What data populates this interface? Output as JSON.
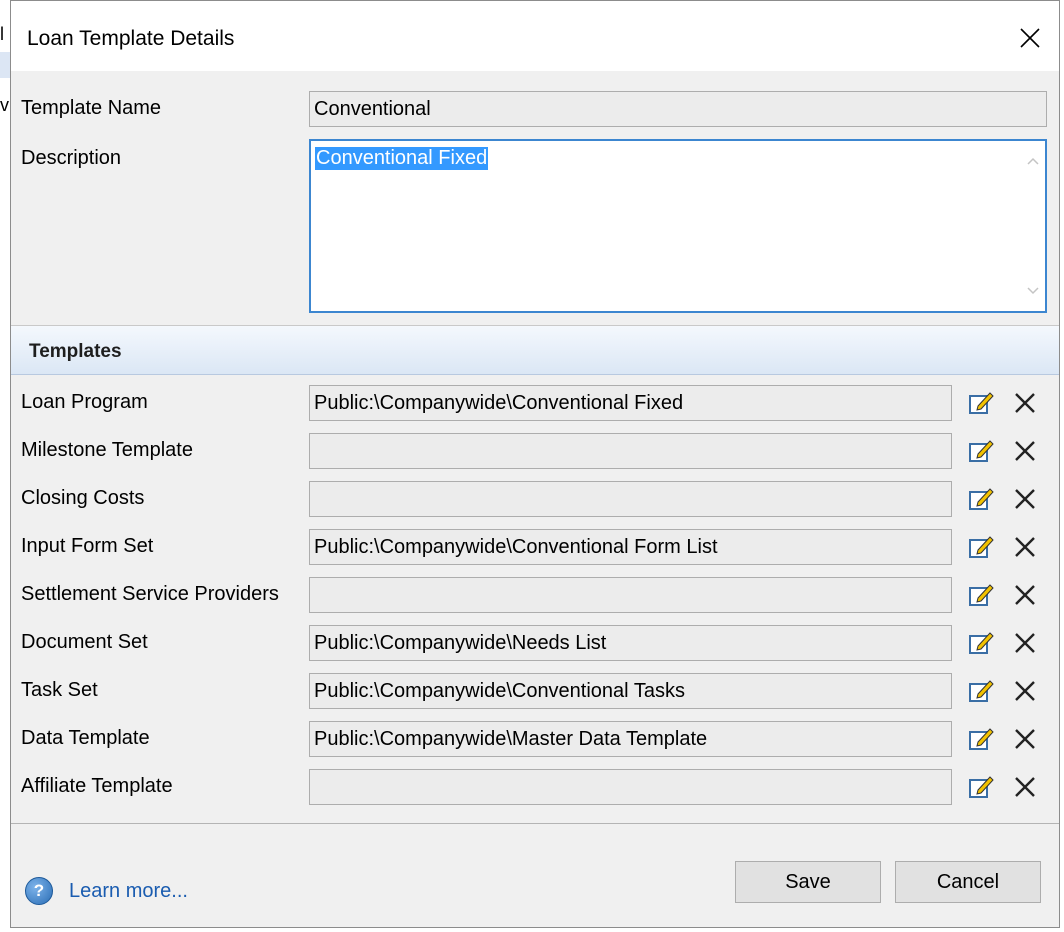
{
  "dialog": {
    "title": "Loan Template Details"
  },
  "fields": {
    "template_name": {
      "label": "Template Name",
      "value": "Conventional"
    },
    "description": {
      "label": "Description",
      "value": "Conventional Fixed"
    }
  },
  "templates_section": {
    "title": "Templates",
    "rows": [
      {
        "label": "Loan Program",
        "value": "Public:\\Companywide\\Conventional Fixed"
      },
      {
        "label": "Milestone Template",
        "value": ""
      },
      {
        "label": "Closing Costs",
        "value": ""
      },
      {
        "label": "Input Form Set",
        "value": "Public:\\Companywide\\Conventional Form List"
      },
      {
        "label": "Settlement Service Providers",
        "value": ""
      },
      {
        "label": "Document Set",
        "value": "Public:\\Companywide\\Needs List"
      },
      {
        "label": "Task Set",
        "value": "Public:\\Companywide\\Conventional Tasks"
      },
      {
        "label": "Data Template",
        "value": "Public:\\Companywide\\Master Data Template"
      },
      {
        "label": "Affiliate Template",
        "value": ""
      }
    ]
  },
  "footer": {
    "help_label": "Learn more...",
    "save_label": "Save",
    "cancel_label": "Cancel"
  },
  "background_window": {
    "fragment_1": "l",
    "fragment_2": "vi"
  },
  "icons": {
    "close": "close-icon",
    "edit": "edit-icon",
    "clear": "clear-icon",
    "help": "help-icon"
  },
  "colors": {
    "accent": "#3c86d0",
    "selection": "#3399ff",
    "link": "#1a5cb0",
    "section_header": "#dbe7f5"
  }
}
